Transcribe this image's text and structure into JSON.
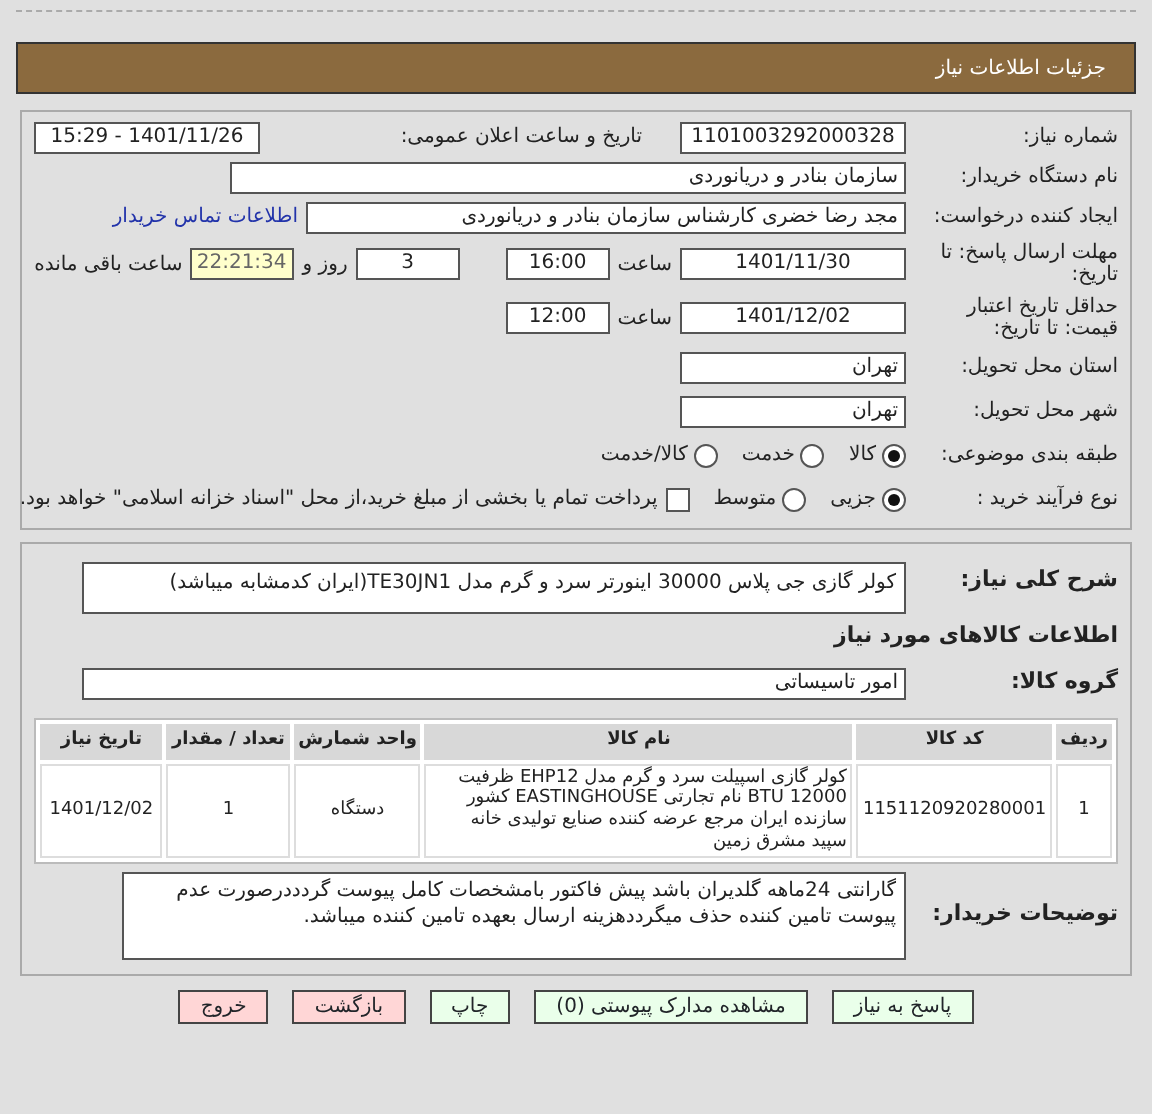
{
  "header": {
    "title": "جزئیات اطلاعات نیاز"
  },
  "need_number": {
    "label": "شماره نیاز:",
    "value": "1101003292000328"
  },
  "announce": {
    "label": "تاریخ و ساعت اعلان عمومی:",
    "value": "1401/11/26 - 15:29"
  },
  "buyer": {
    "label": "نام دستگاه خریدار:",
    "value": "سازمان بنادر و دریانوردی"
  },
  "creator": {
    "label": "ایجاد کننده درخواست:",
    "value": "مجد رضا خضری کارشناس سازمان بنادر و دریانوردی",
    "link": "اطلاعات تماس خریدار"
  },
  "deadline": {
    "label": "مهلت ارسال پاسخ: تا تاریخ:",
    "date": "1401/11/30",
    "time_label": "ساعت",
    "time": "16:00",
    "days": "3",
    "days_label": "روز و",
    "remaining": "22:21:34",
    "remaining_label": "ساعت باقی مانده"
  },
  "validity": {
    "label": "حداقل تاریخ اعتبار قیمت: تا تاریخ:",
    "date": "1401/12/02",
    "time_label": "ساعت",
    "time": "12:00"
  },
  "province": {
    "label": "استان محل تحویل:",
    "value": "تهران"
  },
  "city": {
    "label": "شهر محل تحویل:",
    "value": "تهران"
  },
  "category": {
    "label": "طبقه بندی موضوعی:",
    "options": [
      {
        "label": "کالا",
        "selected": true
      },
      {
        "label": "خدمت",
        "selected": false
      },
      {
        "label": "کالا/خدمت",
        "selected": false
      }
    ]
  },
  "process": {
    "label": "نوع فرآیند خرید :",
    "options": [
      {
        "label": "جزیی",
        "selected": true
      },
      {
        "label": "متوسط",
        "selected": false
      }
    ],
    "treasury": {
      "label": "پرداخت تمام یا بخشی از مبلغ خرید،از محل \"اسناد خزانه اسلامی\" خواهد بود.",
      "checked": false
    }
  },
  "summary": {
    "label": "شرح کلی نیاز:",
    "value": "کولر گازی جی پلاس 30000 اینورتر سرد و گرم مدل TE30JN1(ایران کدمشابه میباشد)"
  },
  "goods_heading": "اطلاعات کالاهای مورد نیاز",
  "goods_group": {
    "label": "گروه کالا:",
    "value": "امور تاسیساتی"
  },
  "table": {
    "columns": [
      "ردیف",
      "کد کالا",
      "نام کالا",
      "واحد شمارش",
      "تعداد / مقدار",
      "تاریخ نیاز"
    ],
    "rows": [
      [
        "1",
        "1151120920280001",
        "کولر گازی اسپیلت سرد و گرم مدل EHP12 ظرفیت BTU 12000 نام تجارتی EASTINGHOUSE کشور سازنده ایران مرجع عرضه کننده صنایع تولیدی خانه سپید مشرق زمین",
        "دستگاه",
        "1",
        "1401/12/02"
      ]
    ]
  },
  "buyer_notes": {
    "label": "توضیحات خریدار:",
    "value": "گارانتی 24ماهه گلدیران باشد پیش فاکتور بامشخصات کامل پیوست گردددرصورت عدم پیوست تامین کننده حذف میگرددهزینه ارسال بعهده تامین کننده میباشد."
  },
  "buttons": [
    {
      "label": "پاسخ به نیاز",
      "kind": "action"
    },
    {
      "label": "مشاهده مدارک پیوستی (0)",
      "kind": "action"
    },
    {
      "label": "چاپ",
      "kind": "action"
    },
    {
      "label": "بازگشت",
      "kind": "exit"
    },
    {
      "label": "خروج",
      "kind": "exit"
    }
  ]
}
